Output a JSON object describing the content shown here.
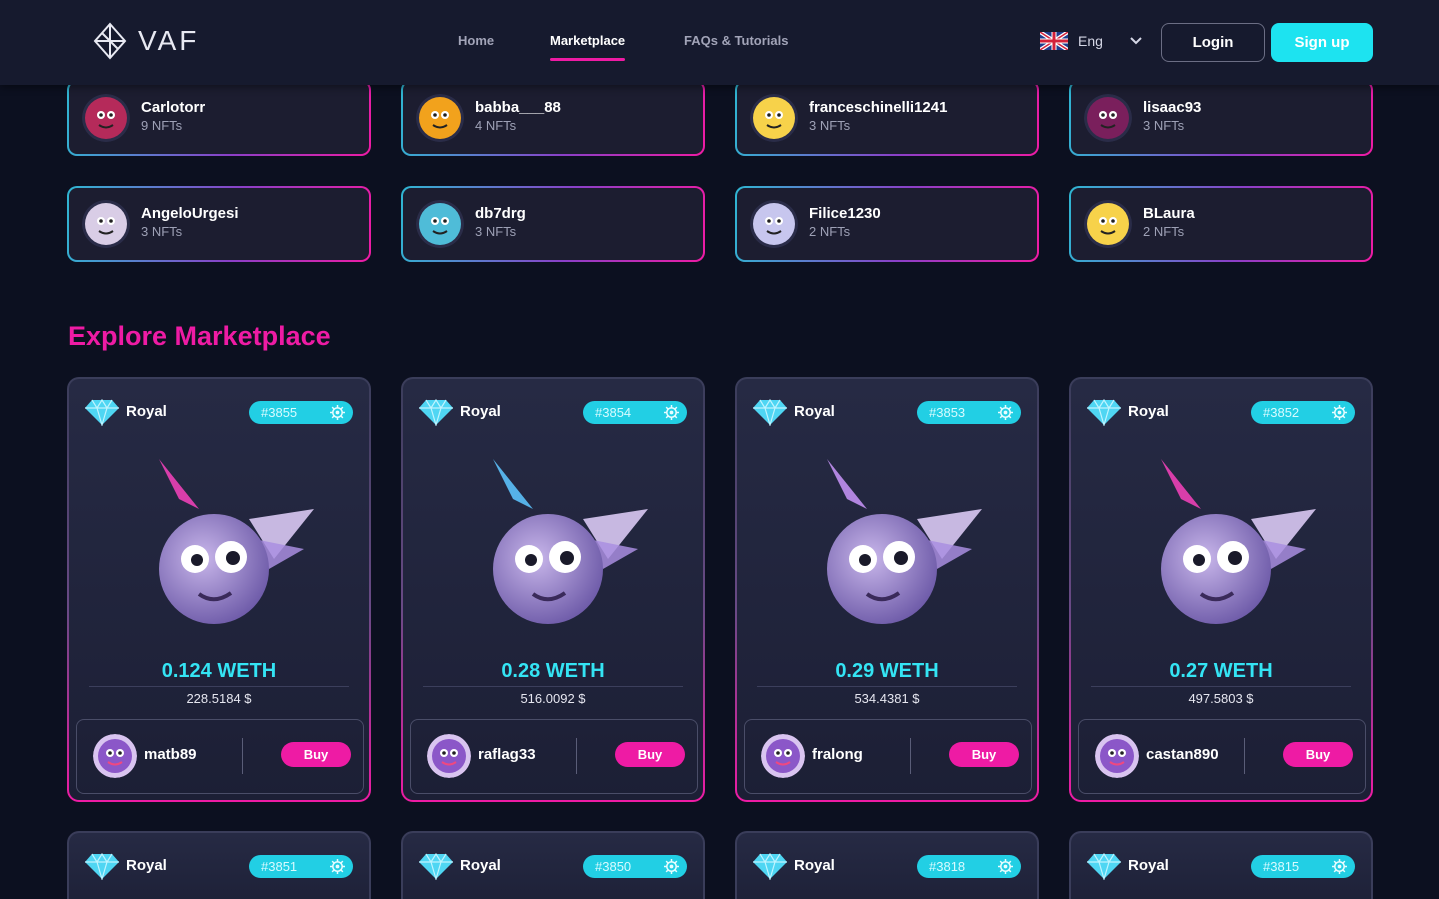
{
  "header": {
    "logo_text": "VAF",
    "nav": [
      {
        "label": "Home",
        "active": false
      },
      {
        "label": "Marketplace",
        "active": true
      },
      {
        "label": "FAQs & Tutorials",
        "active": false
      }
    ],
    "language": {
      "label": "Eng",
      "flag_icon": "uk-flag-icon"
    },
    "login_label": "Login",
    "signup_label": "Sign up"
  },
  "sellers": [
    {
      "name": "Carlotorr",
      "count": "9 NFTs",
      "avatar_color": "#b52a5a"
    },
    {
      "name": "babba___88",
      "count": "4 NFTs",
      "avatar_color": "#f2a21c"
    },
    {
      "name": "franceschinelli1241",
      "count": "3 NFTs",
      "avatar_color": "#f7d24a"
    },
    {
      "name": "lisaac93",
      "count": "3 NFTs",
      "avatar_color": "#7a1f5c"
    },
    {
      "name": "AngeloUrgesi",
      "count": "3 NFTs",
      "avatar_color": "#d9cde6"
    },
    {
      "name": "db7drg",
      "count": "3 NFTs",
      "avatar_color": "#4fbcd8"
    },
    {
      "name": "Filice1230",
      "count": "2 NFTs",
      "avatar_color": "#c7c6ee"
    },
    {
      "name": "BLaura",
      "count": "2 NFTs",
      "avatar_color": "#f7d24a"
    }
  ],
  "marketplace": {
    "title": "Explore Marketplace",
    "buy_label": "Buy",
    "cards": [
      {
        "tier": "Royal",
        "id": "#3855",
        "price": "0.124 WETH",
        "usd": "228.5184 $",
        "owner": "matb89",
        "horn_color": "#e33fb0"
      },
      {
        "tier": "Royal",
        "id": "#3854",
        "price": "0.28 WETH",
        "usd": "516.0092 $",
        "owner": "raflag33",
        "horn_color": "#5ab8f0"
      },
      {
        "tier": "Royal",
        "id": "#3853",
        "price": "0.29 WETH",
        "usd": "534.4381 $",
        "owner": "fralong",
        "horn_color": "#b98ae8"
      },
      {
        "tier": "Royal",
        "id": "#3852",
        "price": "0.27 WETH",
        "usd": "497.5803 $",
        "owner": "castan890",
        "horn_color": "#e33fb0"
      }
    ],
    "next_row": [
      {
        "tier": "Royal",
        "id": "#3851"
      },
      {
        "tier": "Royal",
        "id": "#3850"
      },
      {
        "tier": "Royal",
        "id": "#3818"
      },
      {
        "tier": "Royal",
        "id": "#3815"
      }
    ]
  }
}
